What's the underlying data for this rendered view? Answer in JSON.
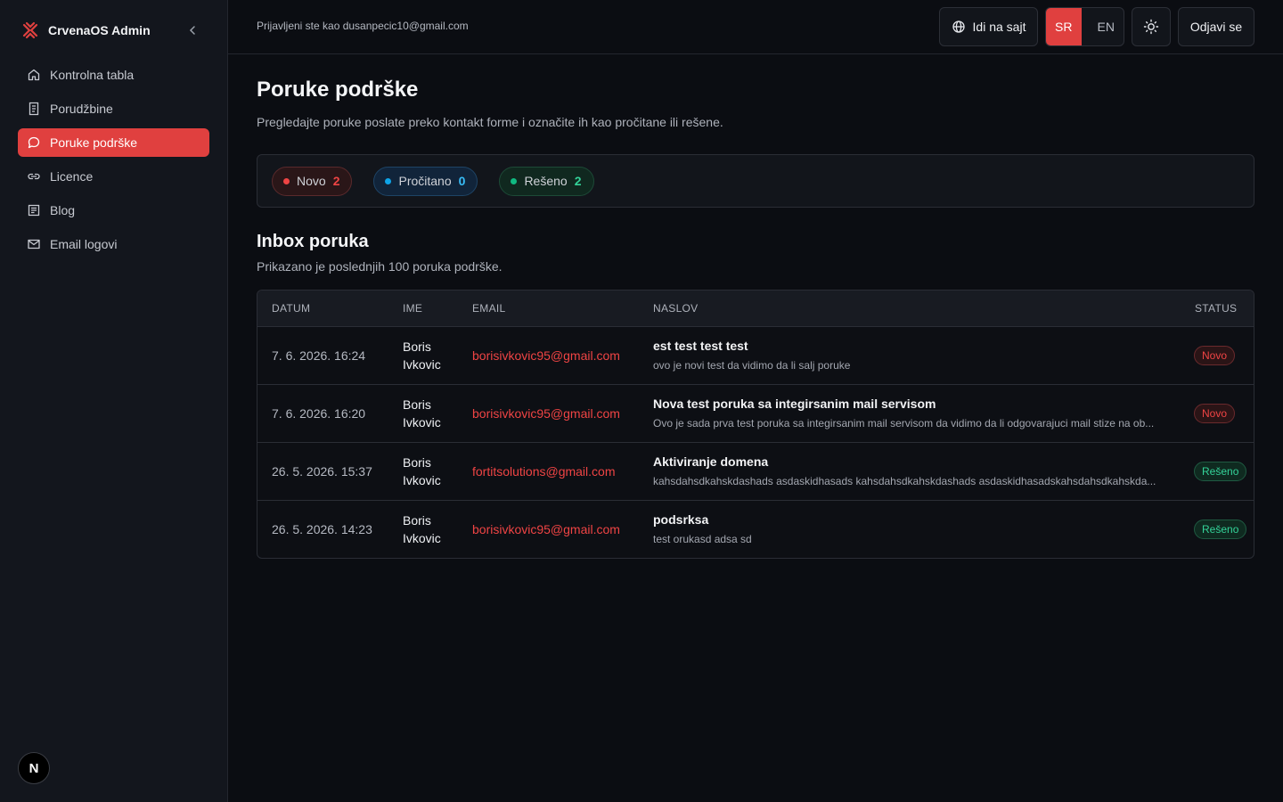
{
  "app": {
    "title": "CrvenaOS Admin",
    "avatar_letter": "N"
  },
  "sidebar": {
    "items": [
      {
        "label": "Kontrolna tabla",
        "icon": "home-icon",
        "active": false
      },
      {
        "label": "Porudžbine",
        "icon": "receipt-icon",
        "active": false
      },
      {
        "label": "Poruke podrške",
        "icon": "message-circle-icon",
        "active": true
      },
      {
        "label": "Licence",
        "icon": "link-icon",
        "active": false
      },
      {
        "label": "Blog",
        "icon": "newspaper-icon",
        "active": false
      },
      {
        "label": "Email logovi",
        "icon": "mail-icon",
        "active": false
      }
    ]
  },
  "header": {
    "login_info": "Prijavljeni ste kao dusanpecic10@gmail.com",
    "site_button": "Idi na sajt",
    "lang_sr": "SR",
    "lang_en": "EN",
    "logout_button": "Odjavi se"
  },
  "page": {
    "title": "Poruke podrške",
    "description": "Pregledajte poruke poslate preko kontakt forme i označite ih kao pročitane ili rešene."
  },
  "stats": {
    "new": {
      "label": "Novo",
      "count": "2"
    },
    "read": {
      "label": "Pročitano",
      "count": "0"
    },
    "solved": {
      "label": "Rešeno",
      "count": "2"
    }
  },
  "inbox": {
    "title": "Inbox poruka",
    "description": "Prikazano je poslednjih 100 poruka podrške.",
    "columns": {
      "date": "DATUM",
      "name": "IME",
      "email": "EMAIL",
      "subject": "NASLOV",
      "status": "STATUS"
    },
    "rows": [
      {
        "date": "7. 6. 2026. 16:24",
        "name": "Boris Ivkovic",
        "email": "borisivkovic95@gmail.com",
        "subject": "est test test test",
        "preview": "ovo je novi test da vidimo da li salj poruke",
        "status": "Novo"
      },
      {
        "date": "7. 6. 2026. 16:20",
        "name": "Boris Ivkovic",
        "email": "borisivkovic95@gmail.com",
        "subject": "Nova test poruka sa integirsanim mail servisom",
        "preview": "Ovo je sada prva test poruka sa integirsanim mail servisom da vidimo da li odgovarajuci mail stize na ob...",
        "status": "Novo"
      },
      {
        "date": "26. 5. 2026. 15:37",
        "name": "Boris Ivkovic",
        "email": "fortitsolutions@gmail.com",
        "subject": "Aktiviranje domena",
        "preview": "kahsdahsdkahskdashads asdaskidhasads kahsdahsdkahskdashads asdaskidhasadskahsdahsdkahskda...",
        "status": "Rešeno"
      },
      {
        "date": "26. 5. 2026. 14:23",
        "name": "Boris Ivkovic",
        "email": "borisivkovic95@gmail.com",
        "subject": "podsrksa",
        "preview": "test orukasd adsa sd",
        "status": "Rešeno"
      }
    ]
  },
  "colors": {
    "accent": "#e0403f",
    "background": "#0b0d12",
    "sidebar": "#13161d"
  }
}
